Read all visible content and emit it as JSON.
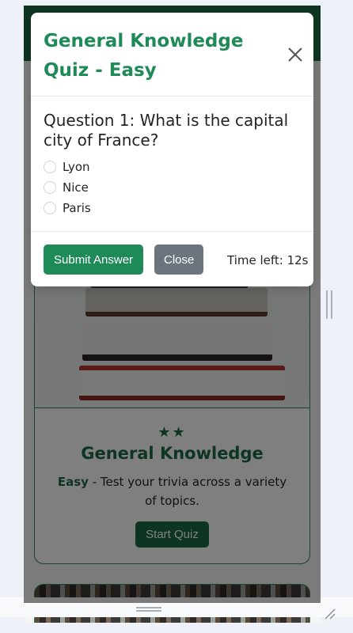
{
  "modal": {
    "title": "General Knowledge Quiz - Easy",
    "question": "Question 1: What is the capital city of France?",
    "options": [
      "Lyon",
      "Nice",
      "Paris"
    ],
    "submit_label": "Submit Answer",
    "close_label": "Close",
    "timer": "Time left: 12s"
  },
  "card": {
    "stars": "★★",
    "title": "General Knowledge",
    "difficulty": "Easy",
    "description": " - Test your trivia across a variety of topics.",
    "button_label": "Start Quiz"
  },
  "colors": {
    "brand": "#1d6b44",
    "accent": "#1d8a58",
    "secondary": "#6c757d"
  },
  "icons": [
    "close-icon",
    "drag-handle-icon",
    "resize-corner-icon"
  ]
}
